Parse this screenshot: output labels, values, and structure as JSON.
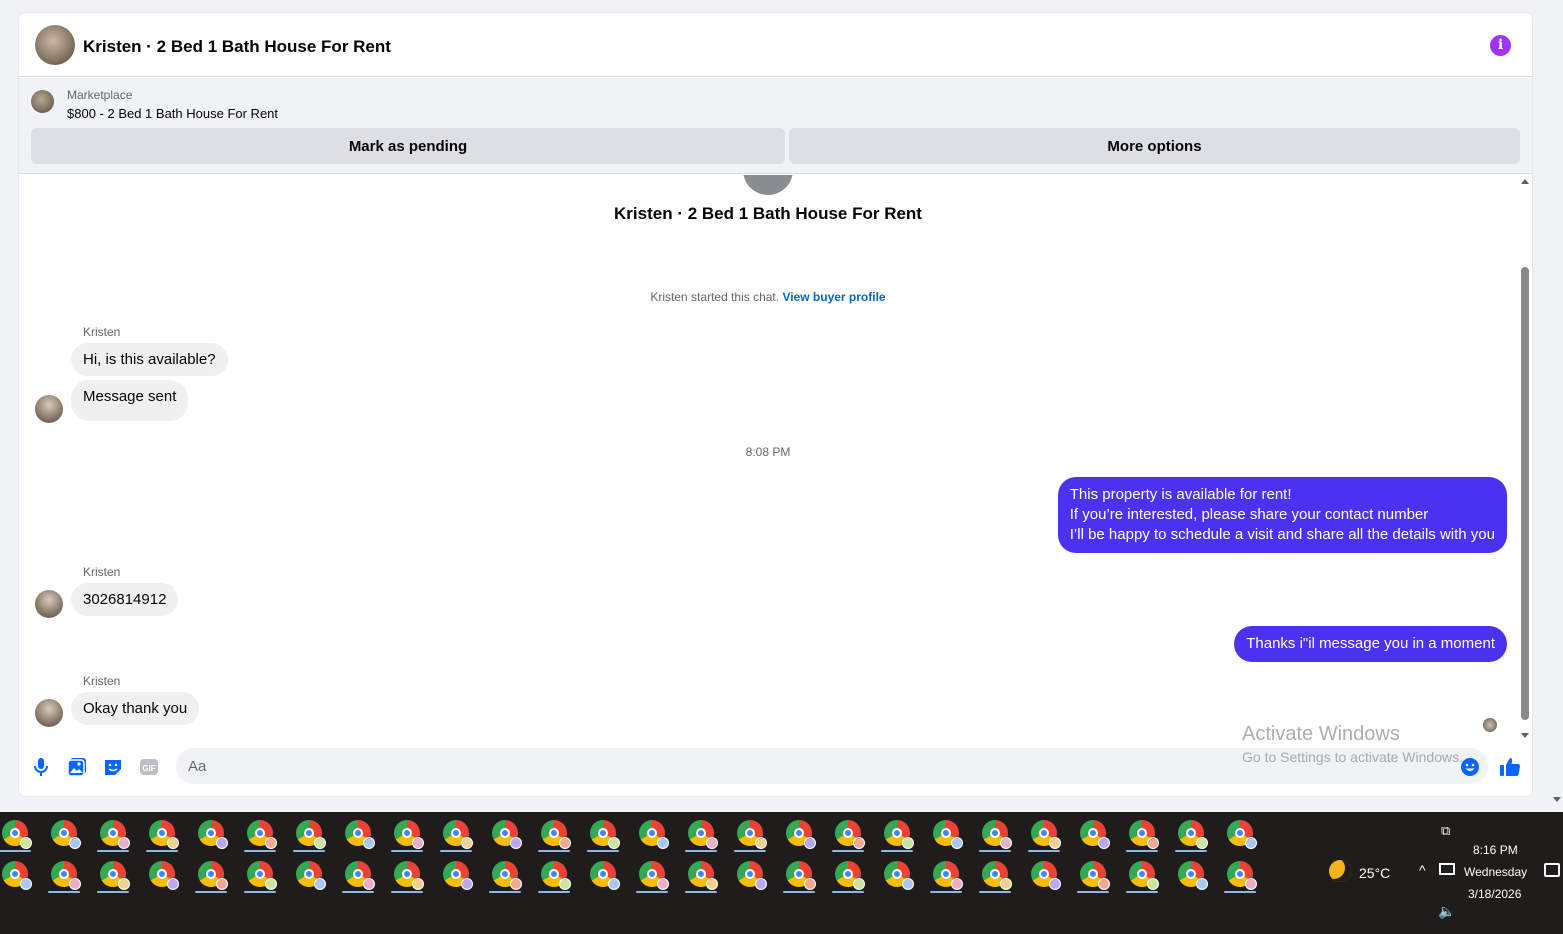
{
  "header": {
    "title": "Kristen · 2 Bed 1 Bath House For Rent",
    "info_icon": "i"
  },
  "marketplace": {
    "label": "Marketplace",
    "listing": "$800 - 2 Bed 1 Bath House For Rent",
    "mark_pending_label": "Mark as pending",
    "more_options_label": "More options"
  },
  "conversation": {
    "title": "Kristen · 2 Bed 1 Bath House For Rent",
    "started_text": "Kristen started this chat.",
    "view_profile_label": "View buyer profile",
    "timestamp": "8:08 PM",
    "sender": "Kristen",
    "messages": [
      {
        "from": "Kristen",
        "text": "Hi, is this available?"
      },
      {
        "from": "Kristen",
        "text": "Message sent"
      },
      {
        "from": "me",
        "lines": [
          "This property is available for rent!",
          "If you’re interested, please share your contact number",
          "I’ll be happy to schedule a visit and share all the details with you"
        ]
      },
      {
        "from": "Kristen",
        "text": "3026814912"
      },
      {
        "from": "me",
        "text": "Thanks i\"il message you in a moment"
      },
      {
        "from": "Kristen",
        "text": "Okay thank you"
      }
    ]
  },
  "composer": {
    "placeholder": "Aa",
    "icons": [
      "microphone-icon",
      "image-icon",
      "sticker-icon",
      "gif-icon",
      "emoji-icon",
      "like-icon"
    ],
    "gif_label": "GIF"
  },
  "watermark": {
    "title": "Activate Windows",
    "subtitle": "Go to Settings to activate Windows."
  },
  "taskbar": {
    "temperature": "25°C",
    "time": "8:16 PM",
    "day": "Wednesday",
    "date": "3/18/2026"
  },
  "colors": {
    "outgoing_bubble": "#4a32f0",
    "incoming_bubble": "#f0f0f0",
    "link": "#0a66c2",
    "accent": "#0866ff",
    "info_icon": "#a033ff"
  }
}
